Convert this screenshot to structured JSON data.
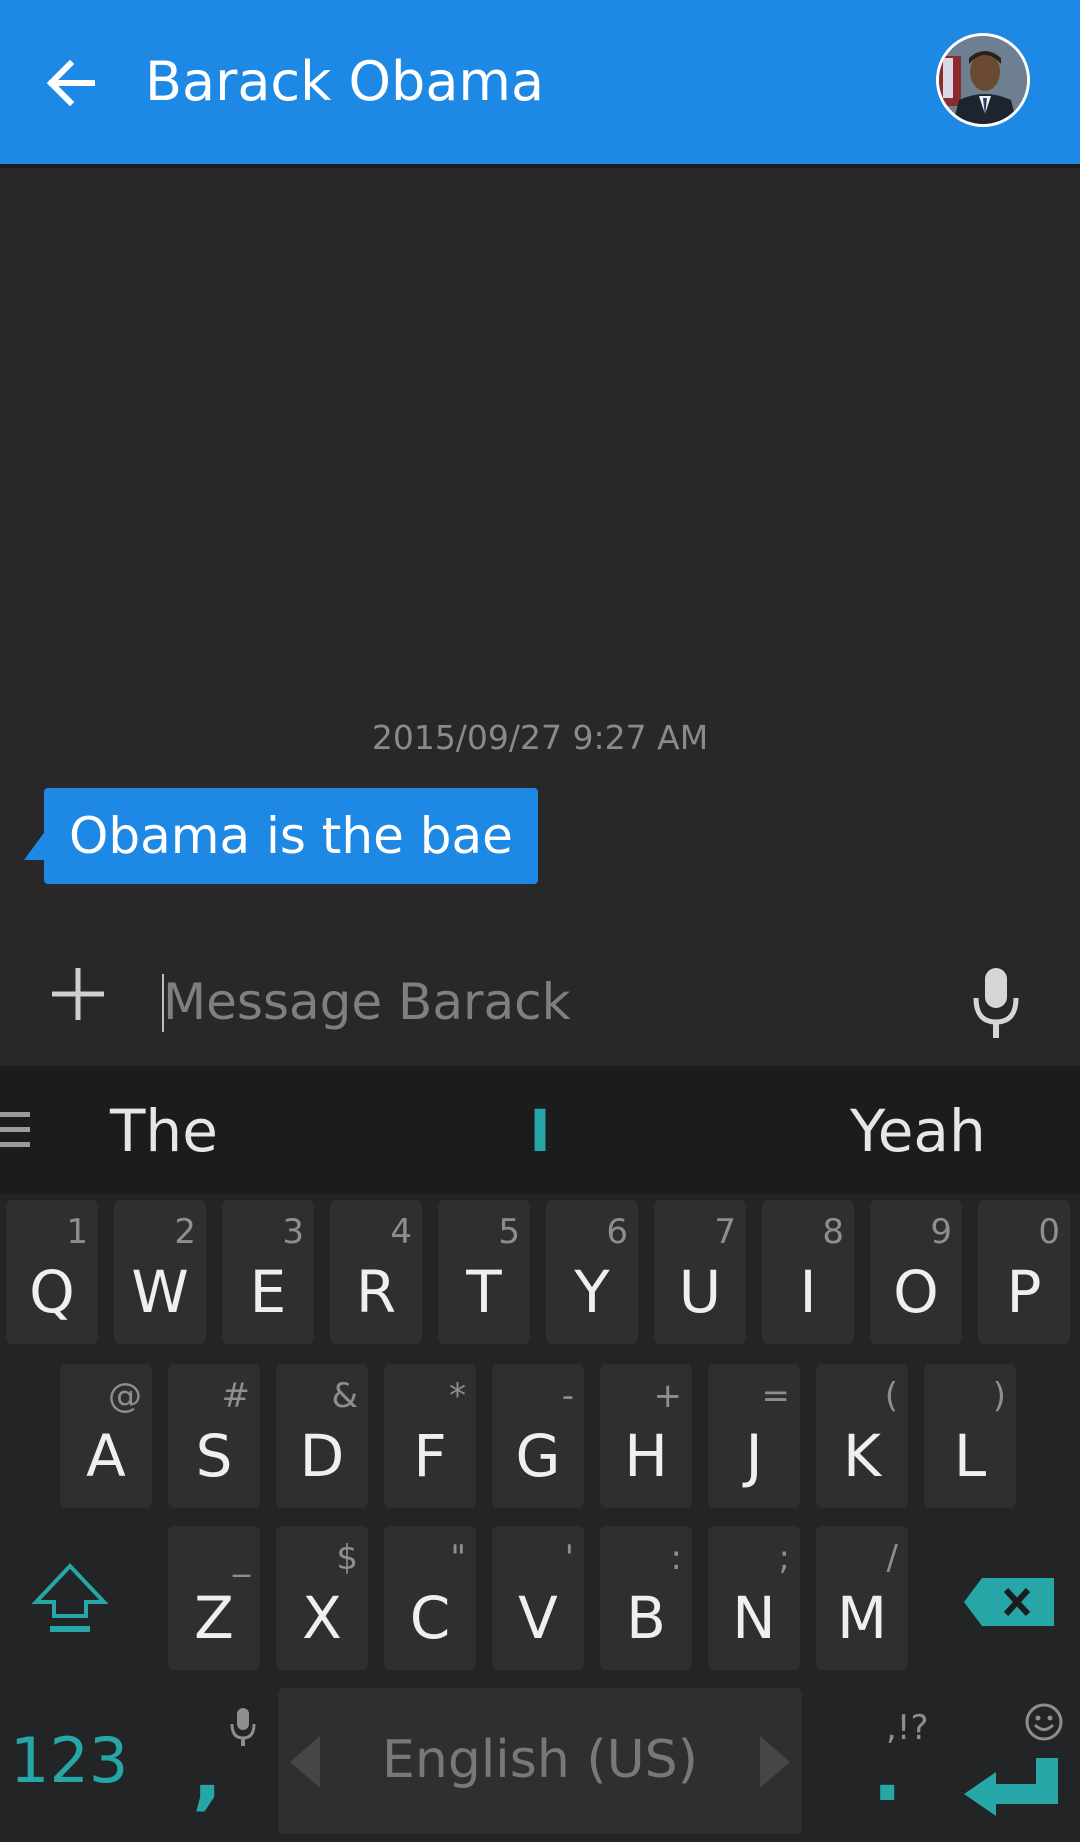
{
  "header": {
    "title": "Barack Obama",
    "accent_color": "#1e88e5",
    "back_icon": "arrow-left-icon",
    "avatar": "contact-avatar"
  },
  "conversation": {
    "timestamp": "2015/09/27 9:27 AM",
    "messages": [
      {
        "text": "Obama is the bae",
        "direction": "incoming"
      }
    ]
  },
  "composer": {
    "placeholder": "Message Barack",
    "value": "",
    "attach_icon": "plus-icon",
    "mic_icon": "mic-icon"
  },
  "keyboard": {
    "suggestions": [
      "The",
      "I",
      "Yeah"
    ],
    "row1": [
      {
        "main": "Q",
        "hint": "1"
      },
      {
        "main": "W",
        "hint": "2"
      },
      {
        "main": "E",
        "hint": "3"
      },
      {
        "main": "R",
        "hint": "4"
      },
      {
        "main": "T",
        "hint": "5"
      },
      {
        "main": "Y",
        "hint": "6"
      },
      {
        "main": "U",
        "hint": "7"
      },
      {
        "main": "I",
        "hint": "8"
      },
      {
        "main": "O",
        "hint": "9"
      },
      {
        "main": "P",
        "hint": "0"
      }
    ],
    "row2": [
      {
        "main": "A",
        "hint": "@"
      },
      {
        "main": "S",
        "hint": "#"
      },
      {
        "main": "D",
        "hint": "&"
      },
      {
        "main": "F",
        "hint": "*"
      },
      {
        "main": "G",
        "hint": "-"
      },
      {
        "main": "H",
        "hint": "+"
      },
      {
        "main": "J",
        "hint": "="
      },
      {
        "main": "K",
        "hint": "("
      },
      {
        "main": "L",
        "hint": ")"
      }
    ],
    "row3": [
      {
        "main": "Z",
        "hint": "_"
      },
      {
        "main": "X",
        "hint": "$"
      },
      {
        "main": "C",
        "hint": "\""
      },
      {
        "main": "V",
        "hint": "'"
      },
      {
        "main": "B",
        "hint": ":"
      },
      {
        "main": "N",
        "hint": ";"
      },
      {
        "main": "M",
        "hint": "/"
      }
    ],
    "numbers_key": "123",
    "comma_key": ",",
    "period_key": ".",
    "period_hint": ",!?",
    "space_label": "English (US)",
    "keyboard_accent": "#26a6a6"
  }
}
